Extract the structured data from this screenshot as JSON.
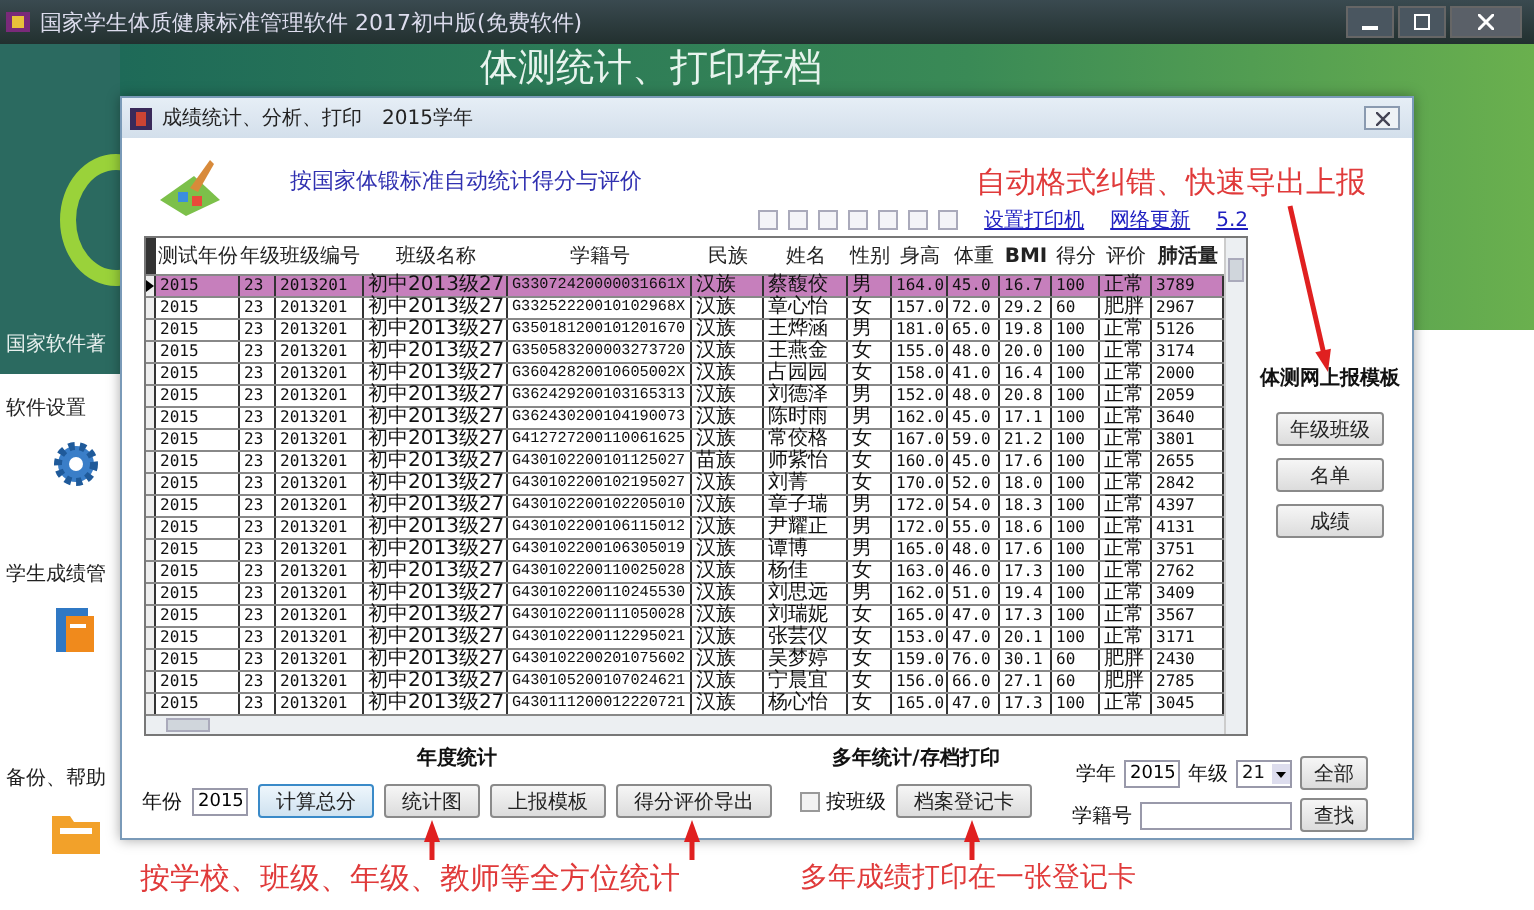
{
  "app_window": {
    "title": "国家学生体质健康标准管理软件 2017初中版(免费软件)",
    "banner": "体测统计、打印存档",
    "sidebar": [
      {
        "kind": "note",
        "label": "国家软件著"
      },
      {
        "kind": "section",
        "label": "软件设置"
      },
      {
        "kind": "section",
        "label": "学生成绩管"
      },
      {
        "kind": "section",
        "label": "备份、帮助"
      }
    ]
  },
  "dialog": {
    "title": "成绩统计、分析、打印　2015学年",
    "heading": "按国家体锻标准自动统计得分与评价",
    "links": [
      "设置打印机",
      "网络更新"
    ],
    "version": "5.2",
    "table": {
      "columns": [
        "测试年份",
        "年级",
        "班级编号",
        "班级名称",
        "学籍号",
        "民族",
        "姓名",
        "性别",
        "身高",
        "体重",
        "BMI",
        "得分",
        "评价",
        "肺活量"
      ],
      "rows": [
        {
          "selected": true,
          "cells": [
            "2015",
            "23",
            "2013201",
            "初中2013级27",
            "G33072420000031661X",
            "汉族",
            "蔡馥佼",
            "男",
            "164.0",
            "45.0",
            "16.7",
            "100",
            "正常",
            "3789"
          ]
        },
        {
          "selected": false,
          "cells": [
            "2015",
            "23",
            "2013201",
            "初中2013级27",
            "G33252220010102968X",
            "汉族",
            "章心怡",
            "女",
            "157.0",
            "72.0",
            "29.2",
            "60",
            "肥胖",
            "2967"
          ]
        },
        {
          "selected": false,
          "cells": [
            "2015",
            "23",
            "2013201",
            "初中2013级27",
            "G350181200101201670",
            "汉族",
            "王烨涵",
            "男",
            "181.0",
            "65.0",
            "19.8",
            "100",
            "正常",
            "5126"
          ]
        },
        {
          "selected": false,
          "cells": [
            "2015",
            "23",
            "2013201",
            "初中2013级27",
            "G350583200003273720",
            "汉族",
            "王燕金",
            "女",
            "155.0",
            "48.0",
            "20.0",
            "100",
            "正常",
            "3174"
          ]
        },
        {
          "selected": false,
          "cells": [
            "2015",
            "23",
            "2013201",
            "初中2013级27",
            "G36042820010605002X",
            "汉族",
            "占园园",
            "女",
            "158.0",
            "41.0",
            "16.4",
            "100",
            "正常",
            "2000"
          ]
        },
        {
          "selected": false,
          "cells": [
            "2015",
            "23",
            "2013201",
            "初中2013级27",
            "G362429200103165313",
            "汉族",
            "刘德泽",
            "男",
            "152.0",
            "48.0",
            "20.8",
            "100",
            "正常",
            "2059"
          ]
        },
        {
          "selected": false,
          "cells": [
            "2015",
            "23",
            "2013201",
            "初中2013级27",
            "G362430200104190073",
            "汉族",
            "陈时雨",
            "男",
            "162.0",
            "45.0",
            "17.1",
            "100",
            "正常",
            "3640"
          ]
        },
        {
          "selected": false,
          "cells": [
            "2015",
            "23",
            "2013201",
            "初中2013级27",
            "G412727200110061625",
            "汉族",
            "常佼格",
            "女",
            "167.0",
            "59.0",
            "21.2",
            "100",
            "正常",
            "3801"
          ]
        },
        {
          "selected": false,
          "cells": [
            "2015",
            "23",
            "2013201",
            "初中2013级27",
            "G430102200101125027",
            "苗族",
            "师紫怡",
            "女",
            "160.0",
            "45.0",
            "17.6",
            "100",
            "正常",
            "2655"
          ]
        },
        {
          "selected": false,
          "cells": [
            "2015",
            "23",
            "2013201",
            "初中2013级27",
            "G430102200102195027",
            "汉族",
            "刘菁",
            "女",
            "170.0",
            "52.0",
            "18.0",
            "100",
            "正常",
            "2842"
          ]
        },
        {
          "selected": false,
          "cells": [
            "2015",
            "23",
            "2013201",
            "初中2013级27",
            "G430102200102205010",
            "汉族",
            "章子瑞",
            "男",
            "172.0",
            "54.0",
            "18.3",
            "100",
            "正常",
            "4397"
          ]
        },
        {
          "selected": false,
          "cells": [
            "2015",
            "23",
            "2013201",
            "初中2013级27",
            "G430102200106115012",
            "汉族",
            "尹耀正",
            "男",
            "172.0",
            "55.0",
            "18.6",
            "100",
            "正常",
            "4131"
          ]
        },
        {
          "selected": false,
          "cells": [
            "2015",
            "23",
            "2013201",
            "初中2013级27",
            "G430102200106305019",
            "汉族",
            "谭博",
            "男",
            "165.0",
            "48.0",
            "17.6",
            "100",
            "正常",
            "3751"
          ]
        },
        {
          "selected": false,
          "cells": [
            "2015",
            "23",
            "2013201",
            "初中2013级27",
            "G430102200110025028",
            "汉族",
            "杨佳",
            "女",
            "163.0",
            "46.0",
            "17.3",
            "100",
            "正常",
            "2762"
          ]
        },
        {
          "selected": false,
          "cells": [
            "2015",
            "23",
            "2013201",
            "初中2013级27",
            "G430102200110245530",
            "汉族",
            "刘思远",
            "男",
            "162.0",
            "51.0",
            "19.4",
            "100",
            "正常",
            "3409"
          ]
        },
        {
          "selected": false,
          "cells": [
            "2015",
            "23",
            "2013201",
            "初中2013级27",
            "G430102200111050028",
            "汉族",
            "刘瑞妮",
            "女",
            "165.0",
            "47.0",
            "17.3",
            "100",
            "正常",
            "3567"
          ]
        },
        {
          "selected": false,
          "cells": [
            "2015",
            "23",
            "2013201",
            "初中2013级27",
            "G430102200112295021",
            "汉族",
            "张芸仪",
            "女",
            "153.0",
            "47.0",
            "20.1",
            "100",
            "正常",
            "3171"
          ]
        },
        {
          "selected": false,
          "cells": [
            "2015",
            "23",
            "2013201",
            "初中2013级27",
            "G430102200201075602",
            "汉族",
            "吴梦婷",
            "女",
            "159.0",
            "76.0",
            "30.1",
            "60",
            "肥胖",
            "2430"
          ]
        },
        {
          "selected": false,
          "cells": [
            "2015",
            "23",
            "2013201",
            "初中2013级27",
            "G430105200107024621",
            "汉族",
            "宁晨宜",
            "女",
            "156.0",
            "66.0",
            "27.1",
            "60",
            "肥胖",
            "2785"
          ]
        },
        {
          "selected": false,
          "cells": [
            "2015",
            "23",
            "2013201",
            "初中2013级27",
            "G430111200012220721",
            "汉族",
            "杨心怡",
            "女",
            "165.0",
            "47.0",
            "17.3",
            "100",
            "正常",
            "3045"
          ]
        }
      ]
    },
    "upload_panel": {
      "title": "体测网上报模板",
      "buttons": [
        "年级班级",
        "名单",
        "成绩"
      ]
    },
    "annual": {
      "title": "年度统计",
      "year_label": "年份",
      "year_value": "2015",
      "buttons": [
        "计算总分",
        "统计图",
        "上报模板",
        "得分评价导出"
      ]
    },
    "multi_year": {
      "title": "多年统计/存档打印",
      "checkbox": {
        "label": "按班级",
        "checked": false
      },
      "button": "档案登记卡"
    },
    "filter": {
      "school_year_label": "学年",
      "school_year": "2015",
      "grade_label": "年级",
      "grade": "21",
      "all_button": "全部",
      "id_label": "学籍号",
      "search_button": "查找"
    }
  },
  "annotations": [
    "自动格式纠错、快速导出上报",
    "按学校、班级、年级、教师等全方位统计",
    "多年成绩打印在一张登记卡"
  ]
}
